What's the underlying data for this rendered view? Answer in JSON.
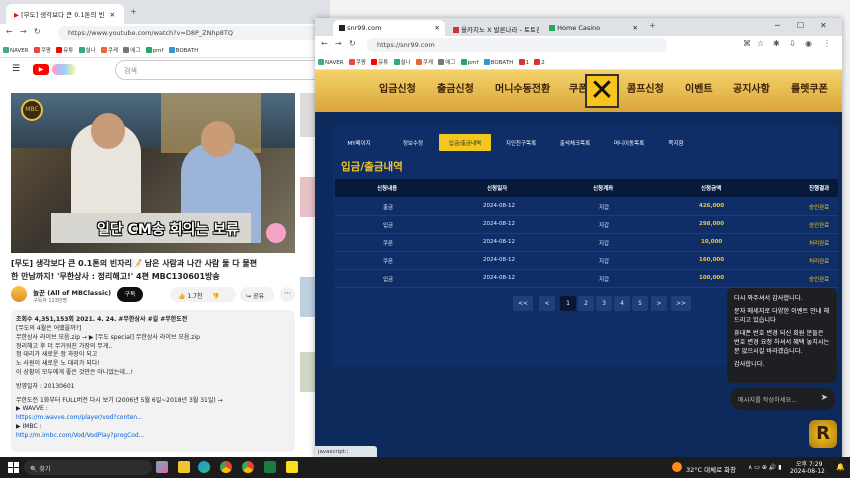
{
  "yt": {
    "tab_title": "[무도] 생각보다 큰 0.1톤의 빈",
    "url": "https://www.youtube.com/watch?v=D8P_ZNhp8TQ",
    "search_placeholder": "검색",
    "video_caption": "일단 CM송 회의는 보류",
    "video_title_1": "[무도] 생각보다 큰 0.1톤의 빈자리📝 남은 사람과 나간 사람 둘 다 물편",
    "video_title_2": "한 만남까지! '무한상사 : 정리해고!' 4편 MBC130601방송",
    "channel": "놀꾼 (All of MBClassic)",
    "subs": "구독자 123만명",
    "subscribe": "구독",
    "likes": "1.7천",
    "share": "공유",
    "desc_meta": "조회수 4,351,153회  2021. 4. 24.  #무한상사 #길 #무한도전",
    "desc_lines": [
      "[무도의 4월은 어땠을까?]",
      "무한상사 라이브 모음.zip →  ▶ [무도 special] 무한상사 라이브 모음.zip",
      "정리해고 후 더 무거워진 가장의 무게..",
      "정 대리가 새로운 정 과장이 되고",
      "노 사원이 새로운 노 대리가 되다!",
      "이 상황이 모두에게 좋은 것만은 아니었는데...!",
      "",
      "방영일자 : 20130601",
      "",
      "무한도전 1화부터 FULL버전 다시 보기 (2006년 5월 6일~2018년 3월 31일) →",
      "▶ WAVVE :",
      "https://m.wavve.com/player/vod?conten...",
      "▶ IMBC :",
      "http://m.imbc.com/Vod/VodPlay?progCod..."
    ]
  },
  "browser": {
    "tabs": [
      "snr99.com",
      "올카지노 X 발론나라 - 토토검",
      "Home Casino"
    ],
    "url": "https://snr99.com",
    "bookmarks": [
      "NAVER",
      "쿠팡",
      "유튜",
      "설나",
      "쿠케",
      "애그",
      "pmf",
      "BOBATH",
      "1",
      "2"
    ]
  },
  "site": {
    "nav": [
      "입금신청",
      "출금신청",
      "머니수동전환",
      "쿠폰",
      "콤프신청",
      "이벤트",
      "공지사항",
      "룰렛쿠폰"
    ],
    "subtabs": [
      "MY페이지",
      "정보수정",
      "입금/출금내역",
      "지인친구목록",
      "출석체크목록",
      "머니이동목록",
      "쪽지함"
    ],
    "active_subtab": "입금/출금내역",
    "section_title": "입금/출금내역",
    "columns": [
      "신청내용",
      "신청일자",
      "신청계좌",
      "신청금액",
      "진행결과"
    ],
    "rows": [
      [
        "출금",
        "2024-08-12",
        "지갑",
        "426,000",
        "승인완료"
      ],
      [
        "입금",
        "2024-08-12",
        "지갑",
        "298,000",
        "승인완료"
      ],
      [
        "쿠폰",
        "2024-08-12",
        "지갑",
        "10,000",
        "처리완료"
      ],
      [
        "쿠폰",
        "2024-08-12",
        "지갑",
        "160,000",
        "처리완료"
      ],
      [
        "입금",
        "2024-08-12",
        "지갑",
        "100,000",
        "승인완료"
      ]
    ],
    "pages": [
      "<<",
      "<",
      "1",
      "2",
      "3",
      "4",
      "5",
      ">",
      ">>"
    ],
    "current_page": "1"
  },
  "chat": {
    "messages": [
      "다시 와주셔서 감사합니다.",
      "",
      "문자 메세지로 다양한 이벤트 안내 해드리고 있습니다",
      "",
      "휴대폰 번호 변경 되신 회원 분들은 번호 변경 요청 하셔서 혜택 놓치시는 분 없으시길 바라겠습니다.",
      "",
      "감사합니다."
    ],
    "input_placeholder": "메시지를 작성하세요..."
  },
  "status_bar": "javascript:;",
  "taskbar": {
    "search": "찾기",
    "weather": "32°C  대체로 화창",
    "time": "오후 7:29",
    "date": "2024-08-12"
  }
}
